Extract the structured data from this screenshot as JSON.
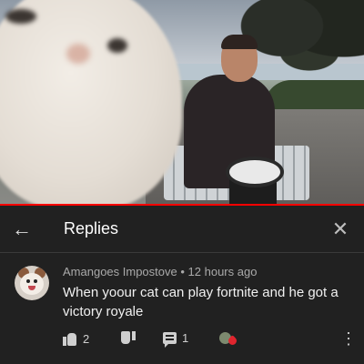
{
  "video": {
    "progress_percent": 100,
    "progress_color": "#ff0000"
  },
  "header": {
    "back_icon": "arrow-left-icon",
    "back_glyph": "←",
    "title": "Replies",
    "close_icon": "close-icon",
    "close_glyph": "✕"
  },
  "comment": {
    "author": "Amangoes Impostove",
    "separator": "•",
    "time": "12 hours ago",
    "text": "When yoour cat can play fortnite and he   got a victory royale",
    "likes": "2",
    "replies": "1",
    "more_glyph": "⋮"
  },
  "colors": {
    "background": "#212121",
    "text_primary": "#f1f1f1",
    "text_secondary": "#aaaaaa"
  }
}
